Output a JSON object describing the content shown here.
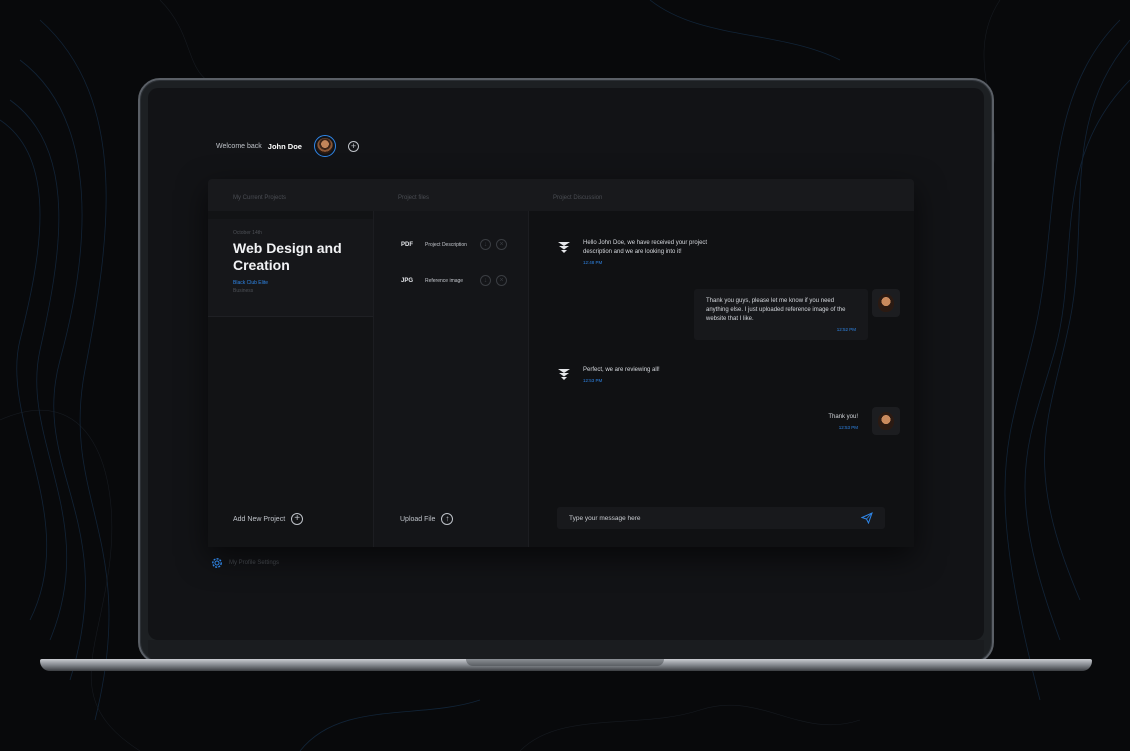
{
  "header": {
    "welcome_text": "Welcome back",
    "user_name": "John Doe"
  },
  "columns": {
    "projects_label": "My Current Projects",
    "files_label": "Project files",
    "discussion_label": "Project Discussion"
  },
  "project": {
    "meta": "October 14th",
    "title": "Web Design and Creation",
    "link": "Black Club Elite",
    "subtitle": "Business"
  },
  "add_project_label": "Add New Project",
  "files": [
    {
      "type": "PDF",
      "name": "Project Description"
    },
    {
      "type": "JPG",
      "name": "Reference image"
    }
  ],
  "upload_label": "Upload File",
  "messages": [
    {
      "side": "left",
      "text": "Hello John Doe, we have received your project description and we are looking into it!",
      "time": "12:48 PM"
    },
    {
      "side": "right",
      "text": "Thank you guys, please let me know if you need anything else. I just uploaded reference image of the website that I like.",
      "time": "12:52 PM"
    },
    {
      "side": "left",
      "text": "Perfect, we are reviewing all!",
      "time": "12:53 PM"
    },
    {
      "side": "right",
      "text": "Thank you!",
      "time": "12:53 PM"
    }
  ],
  "message_input": {
    "placeholder": "Type your message here"
  },
  "settings_label": "My Profile Settings",
  "colors": {
    "accent": "#2f86e8",
    "panel": "#18191c",
    "background": "#08090b"
  }
}
